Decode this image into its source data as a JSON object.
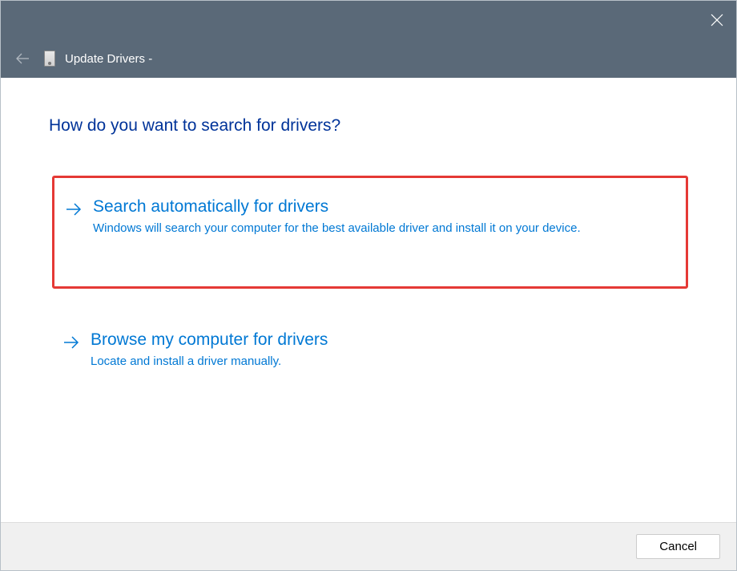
{
  "titlebar": {
    "window_title": "Update Drivers -"
  },
  "content": {
    "heading": "How do you want to search for drivers?",
    "options": [
      {
        "title": "Search automatically for drivers",
        "description": "Windows will search your computer for the best available driver and install it on your device."
      },
      {
        "title": "Browse my computer for drivers",
        "description": "Locate and install a driver manually."
      }
    ]
  },
  "footer": {
    "cancel_label": "Cancel"
  }
}
